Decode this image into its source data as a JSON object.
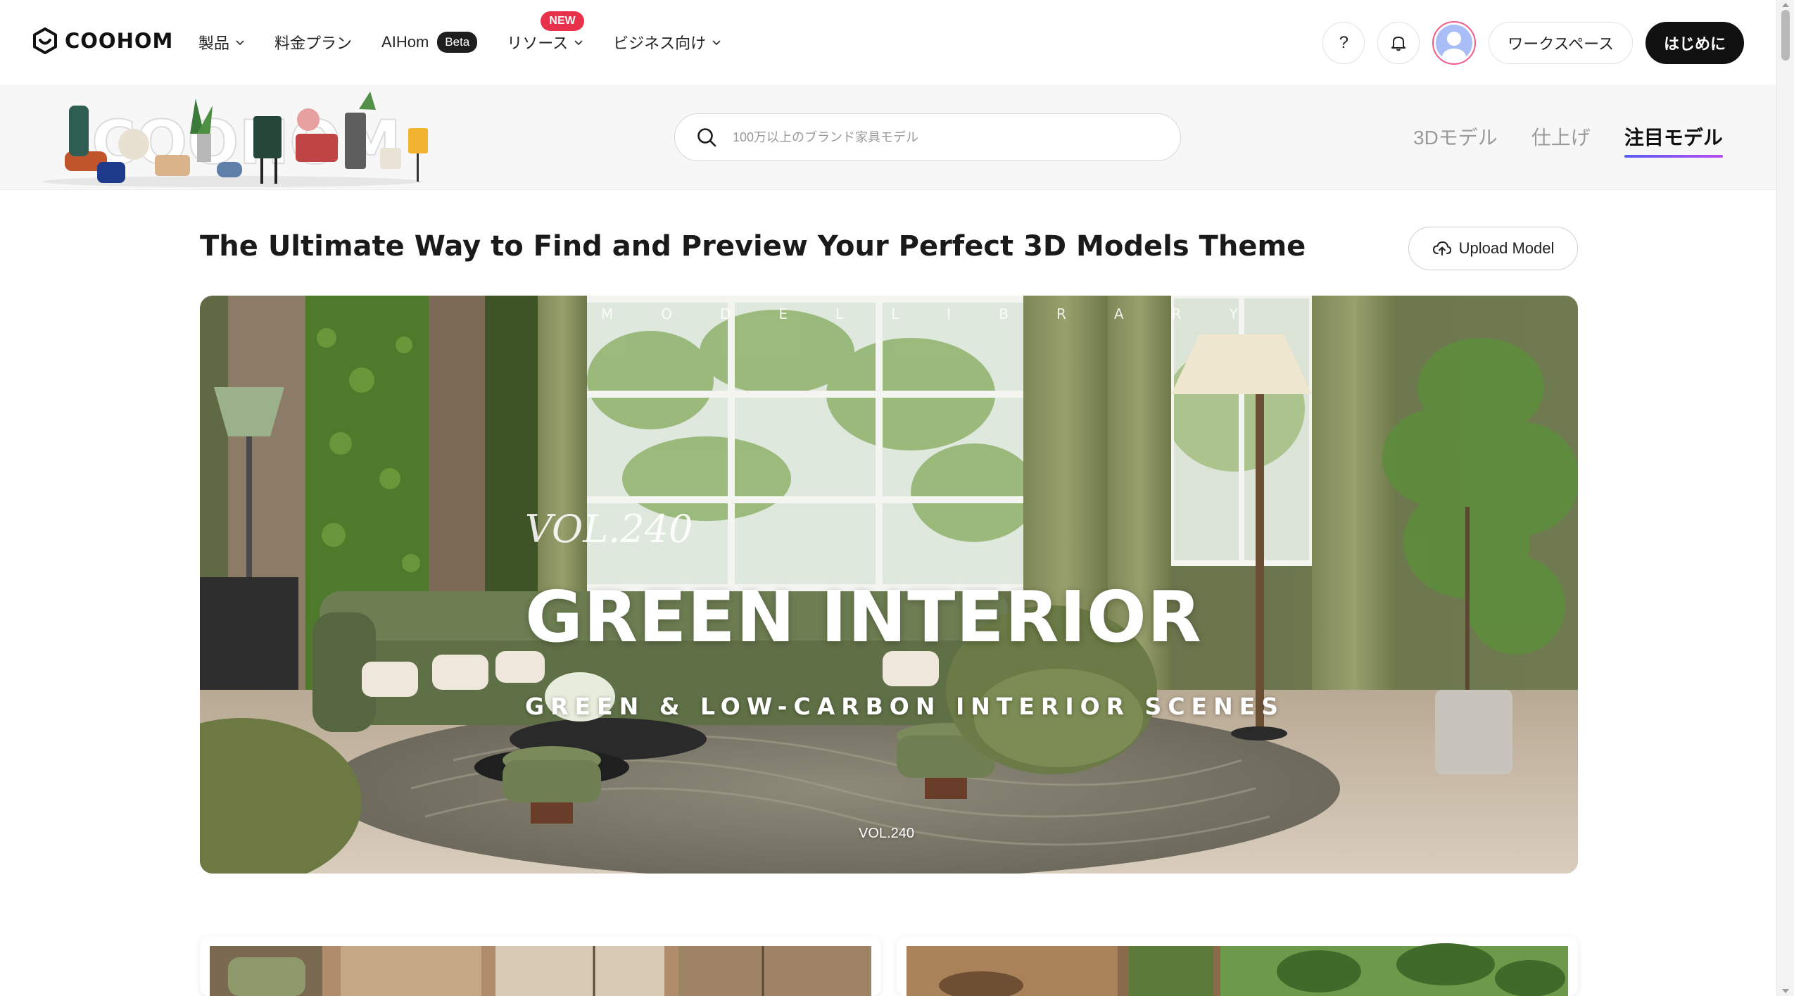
{
  "nav": {
    "logo": "COOHOM",
    "items": [
      {
        "label": "製品",
        "has_dropdown": true
      },
      {
        "label": "料金プラン",
        "has_dropdown": false
      },
      {
        "label": "AIHom",
        "badge": "Beta"
      },
      {
        "label": "リソース",
        "has_dropdown": true,
        "new_badge": "NEW"
      },
      {
        "label": "ビジネス向け",
        "has_dropdown": true
      }
    ],
    "help_label": "?",
    "workspace_label": "ワークスペース",
    "start_label": "はじめに"
  },
  "search": {
    "placeholder": "100万以上のブランド家具モデル"
  },
  "model_tabs": [
    {
      "label": "3Dモデル",
      "active": false
    },
    {
      "label": "仕上げ",
      "active": false
    },
    {
      "label": "注目モデル",
      "active": true
    }
  ],
  "main": {
    "title": "The Ultimate Way to Find and Preview Your Perfect 3D Models Theme",
    "upload_label": "Upload Model"
  },
  "banner": {
    "top_letters": [
      "M",
      "O",
      "D",
      "E",
      "L",
      "L",
      "I",
      "B",
      "R",
      "A",
      "R",
      "Y"
    ],
    "vol_italic": "VOL.240",
    "title": "GREEN INTERIOR",
    "subtitle": "GREEN & LOW-CARBON INTERIOR SCENES",
    "vol": "VOL.240"
  },
  "colors": {
    "accent_gradient_start": "#5a5cf0",
    "accent_gradient_end": "#b64ef0",
    "new_badge": "#e8314a",
    "primary_button": "#111111"
  }
}
